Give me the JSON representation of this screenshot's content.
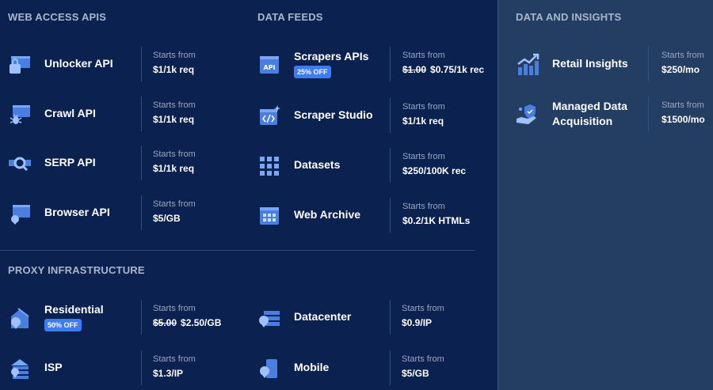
{
  "sections": {
    "web_access": "WEB ACCESS APIS",
    "data_feeds": "DATA FEEDS",
    "data_insights": "DATA AND INSIGHTS",
    "proxy": "PROXY INFRASTRUCTURE"
  },
  "starts_label": "Starts from",
  "web_access": [
    {
      "name": "Unlocker API",
      "price": "$1/1k req",
      "icon": "unlocker-icon"
    },
    {
      "name": "Crawl API",
      "price": "$1/1k req",
      "icon": "crawl-bug-icon"
    },
    {
      "name": "SERP API",
      "price": "$1/1k req",
      "icon": "serp-search-icon"
    },
    {
      "name": "Browser API",
      "price": "$5/GB",
      "icon": "browser-icon"
    }
  ],
  "data_feeds": [
    {
      "name": "Scrapers APIs",
      "badge": "25% OFF",
      "old_price": "$1.00",
      "price": "$0.75/1k rec",
      "icon": "api-icon"
    },
    {
      "name": "Scraper Studio",
      "price": "$1/1k req",
      "icon": "code-sparkle-icon"
    },
    {
      "name": "Datasets",
      "price": "$250/100K rec",
      "icon": "grid-icon"
    },
    {
      "name": "Web Archive",
      "price": "$0.2/1K HTMLs",
      "icon": "archive-icon"
    }
  ],
  "insights": [
    {
      "name": "Retail Insights",
      "price": "$250/mo",
      "icon": "chart-icon"
    },
    {
      "name": "Managed Data Acquisition",
      "price": "$1500/mo",
      "icon": "hand-shield-icon"
    }
  ],
  "proxy": [
    {
      "name": "Residential",
      "badge": "50% OFF",
      "old_price": "$5.00",
      "price": "$2.50/GB",
      "icon": "home-pin-icon"
    },
    {
      "name": "Datacenter",
      "price": "$0.9/IP",
      "icon": "server-pin-icon"
    },
    {
      "name": "ISP",
      "price": "$1.3/IP",
      "icon": "building-pin-icon"
    },
    {
      "name": "Mobile",
      "price": "$5/GB",
      "icon": "mobile-pin-icon"
    }
  ]
}
